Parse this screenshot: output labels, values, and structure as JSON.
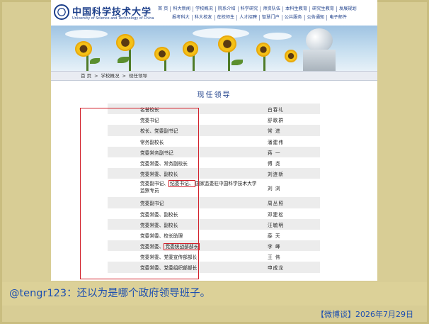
{
  "site": {
    "logo_cn": "中国科学技术大学",
    "logo_en": "University of Science and Technology of China",
    "nav_row1": [
      "首 页",
      "科大新闻",
      "学校概况",
      "院系介绍",
      "科学研究",
      "师资队伍",
      "本科生教育",
      "研究生教育",
      "发展规划"
    ],
    "nav_row2": [
      "报考科大",
      "科大校友",
      "在校师生",
      "人才招聘",
      "智慧门户",
      "公共服务",
      "公告通知",
      "电子邮件"
    ],
    "breadcrumb": [
      "首 页",
      ">",
      "学校概况",
      ">",
      "现任领导"
    ],
    "page_title": "现任领导"
  },
  "leaders": [
    {
      "position": "名誉校长",
      "name": "白春礼"
    },
    {
      "position": "党委书记",
      "name": "舒歌群"
    },
    {
      "position": "校长、党委副书记",
      "name": "常 进"
    },
    {
      "position": "常务副校长",
      "name": "潘建伟"
    },
    {
      "position": "党委常务副书记",
      "name": "蒋 一"
    },
    {
      "position": "党委常委、常务副校长",
      "name": "傅 尧"
    },
    {
      "position": "党委常委、副校长",
      "name": "刘连新"
    },
    {
      "position_pre": "党委副书记、",
      "position_hl": "纪委书记、",
      "position_post": "国家监委驻中国科学技术大学监察专员",
      "name": "刘 浏"
    },
    {
      "position": "党委副书记",
      "name": "周丛照"
    },
    {
      "position": "党委常委、副校长",
      "name": "邓建松"
    },
    {
      "position": "党委常委、副校长",
      "name": "汪毓明"
    },
    {
      "position": "党委常委、校长助理",
      "name": "薛 天"
    },
    {
      "position_pre": "党委常委、",
      "position_hl": "党委统战部部长",
      "position_post": "",
      "name": "李 峰"
    },
    {
      "position": "党委常委、党委宣传部部长",
      "name": "王 伟"
    },
    {
      "position": "党委常委、党委组织部部长",
      "name": "申成龙"
    }
  ],
  "comment": "@tengr123：还以为是哪个政府领导班子。",
  "credit": "【微博谈】2026年7月29日",
  "colors": {
    "brand_blue": "#1d3f8a",
    "highlight_red": "#d2202a",
    "frame_tan": "#d8cd95",
    "comment_blue": "#1d4fb0"
  }
}
